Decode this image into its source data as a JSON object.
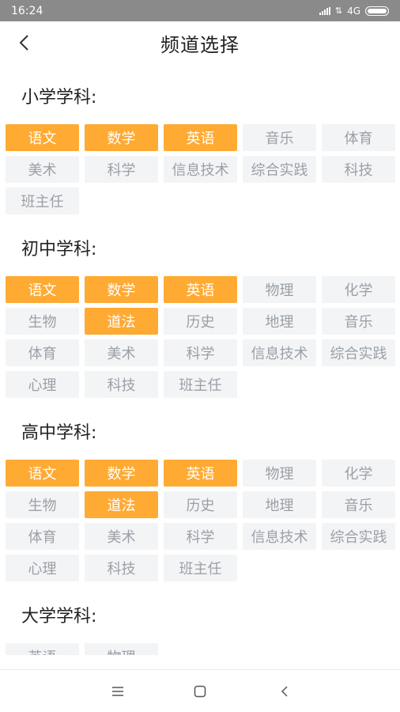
{
  "status_bar": {
    "time": "16:24",
    "network": "4G"
  },
  "header": {
    "title": "频道选择"
  },
  "sections": [
    {
      "title": "小学学科:",
      "subjects": [
        {
          "label": "语文",
          "selected": true
        },
        {
          "label": "数学",
          "selected": true
        },
        {
          "label": "英语",
          "selected": true
        },
        {
          "label": "音乐",
          "selected": false
        },
        {
          "label": "体育",
          "selected": false
        },
        {
          "label": "美术",
          "selected": false
        },
        {
          "label": "科学",
          "selected": false
        },
        {
          "label": "信息技术",
          "selected": false
        },
        {
          "label": "综合实践",
          "selected": false
        },
        {
          "label": "科技",
          "selected": false
        },
        {
          "label": "班主任",
          "selected": false
        }
      ]
    },
    {
      "title": "初中学科:",
      "subjects": [
        {
          "label": "语文",
          "selected": true
        },
        {
          "label": "数学",
          "selected": true
        },
        {
          "label": "英语",
          "selected": true
        },
        {
          "label": "物理",
          "selected": false
        },
        {
          "label": "化学",
          "selected": false
        },
        {
          "label": "生物",
          "selected": false
        },
        {
          "label": "道法",
          "selected": true
        },
        {
          "label": "历史",
          "selected": false
        },
        {
          "label": "地理",
          "selected": false
        },
        {
          "label": "音乐",
          "selected": false
        },
        {
          "label": "体育",
          "selected": false
        },
        {
          "label": "美术",
          "selected": false
        },
        {
          "label": "科学",
          "selected": false
        },
        {
          "label": "信息技术",
          "selected": false
        },
        {
          "label": "综合实践",
          "selected": false
        },
        {
          "label": "心理",
          "selected": false
        },
        {
          "label": "科技",
          "selected": false
        },
        {
          "label": "班主任",
          "selected": false
        }
      ]
    },
    {
      "title": "高中学科:",
      "subjects": [
        {
          "label": "语文",
          "selected": true
        },
        {
          "label": "数学",
          "selected": true
        },
        {
          "label": "英语",
          "selected": true
        },
        {
          "label": "物理",
          "selected": false
        },
        {
          "label": "化学",
          "selected": false
        },
        {
          "label": "生物",
          "selected": false
        },
        {
          "label": "道法",
          "selected": true
        },
        {
          "label": "历史",
          "selected": false
        },
        {
          "label": "地理",
          "selected": false
        },
        {
          "label": "音乐",
          "selected": false
        },
        {
          "label": "体育",
          "selected": false
        },
        {
          "label": "美术",
          "selected": false
        },
        {
          "label": "科学",
          "selected": false
        },
        {
          "label": "信息技术",
          "selected": false
        },
        {
          "label": "综合实践",
          "selected": false
        },
        {
          "label": "心理",
          "selected": false
        },
        {
          "label": "科技",
          "selected": false
        },
        {
          "label": "班主任",
          "selected": false
        }
      ]
    },
    {
      "title": "大学学科:",
      "subjects": [
        {
          "label": "英语",
          "selected": false
        },
        {
          "label": "物理",
          "selected": false
        }
      ]
    }
  ],
  "colors": {
    "accent": "#ffaa33",
    "tag_bg": "#f3f4f6",
    "tag_text": "#9aa0a6",
    "status_bar": "#8a8a8a"
  },
  "icons": {
    "back": "chevron-left-icon",
    "nav_menu": "menu-icon",
    "nav_home": "square-home-icon",
    "nav_back": "triangle-back-icon"
  }
}
